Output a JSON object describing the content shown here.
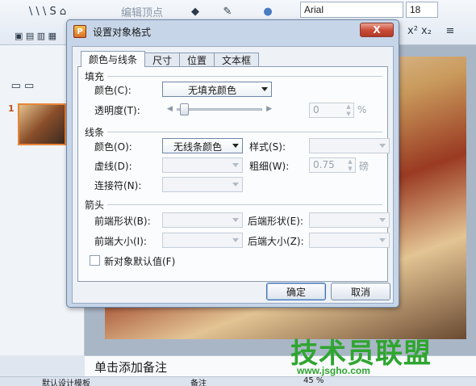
{
  "background": {
    "toolbar_edit_vertex": "编辑顶点",
    "font_name": "Arial",
    "font_size": "18",
    "slide_number": "1",
    "notes_placeholder": "单击添加备注",
    "status_template": "默认设计模板",
    "status_notes": "备注",
    "status_zoom": "45 %"
  },
  "watermark": {
    "text": "技术员联盟",
    "url": "www.jsgho.com"
  },
  "dialog": {
    "title": "设置对象格式",
    "close_label": "X",
    "tabs": [
      {
        "label": "颜色与线条",
        "active": true
      },
      {
        "label": "尺寸",
        "active": false
      },
      {
        "label": "位置",
        "active": false
      },
      {
        "label": "文本框",
        "active": false
      }
    ],
    "fill": {
      "section_label": "填充",
      "color_label": "颜色(C):",
      "color_value": "无填充颜色",
      "transparency_label": "透明度(T):",
      "transparency_value": "0",
      "transparency_unit": "%"
    },
    "line": {
      "section_label": "线条",
      "color_label": "颜色(O):",
      "color_value": "无线条颜色",
      "style_label": "样式(S):",
      "style_value": "",
      "dash_label": "虚线(D):",
      "dash_value": "",
      "weight_label": "粗细(W):",
      "weight_value": "0.75",
      "weight_unit": "磅",
      "connector_label": "连接符(N):",
      "connector_value": ""
    },
    "arrows": {
      "section_label": "箭头",
      "begin_style_label": "前端形状(B):",
      "end_style_label": "后端形状(E):",
      "begin_size_label": "前端大小(I):",
      "end_size_label": "后端大小(Z):"
    },
    "default_checkbox_label": "新对象默认值(F)",
    "ok_label": "确定",
    "cancel_label": "取消"
  }
}
